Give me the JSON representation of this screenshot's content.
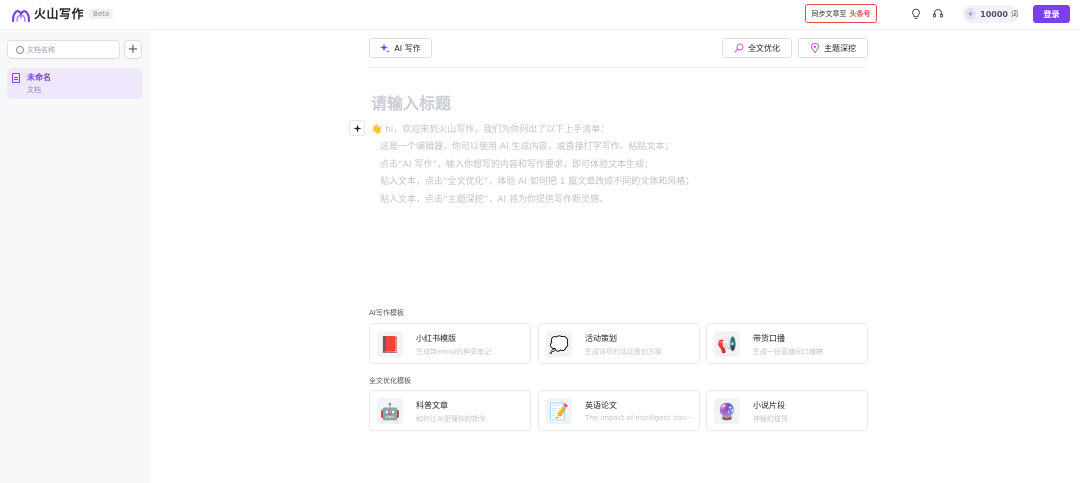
{
  "header": {
    "app_name": "火山写作",
    "beta": "Beta",
    "sync_label": "同步文章至",
    "sync_target": "头条号",
    "quota_value": "10000",
    "quota_unit": "词",
    "quota_badge": "+",
    "login_label": "登录",
    "brand_color": "#7b3ff2"
  },
  "sidebar": {
    "search_placeholder": "文档名称",
    "add_label": "+",
    "documents": [
      {
        "title": "未命名",
        "subtitle": "文档"
      }
    ]
  },
  "toolbar": {
    "ai_write": "AI 写作",
    "full_optimize": "全文优化",
    "topic_deepen": "主题深挖"
  },
  "editor": {
    "title_placeholder": "请输入标题",
    "intro_lines": [
      "👋 hi，欢迎来到火山写作，我们为你列出了以下上手清单：",
      "这是一个编辑器，你可以使用 AI 生成内容，或直接打字写作、粘贴文本；",
      "点击“AI 写作”，输入你想写的内容和写作要求，即可体验文本生成；",
      "贴入文本，点击“全文优化”，体验 AI 如何把 1 篇文章改成不同的文体和风格；",
      "贴入文本，点击“主题深挖”，AI 将为你提供写作新灵感。"
    ]
  },
  "templates": {
    "ai_section_label": "AI写作模板",
    "ai_templates": [
      {
        "icon": "📕",
        "title": "小红书模版",
        "subtitle": "生成带emoji的种草笔记"
      },
      {
        "icon": "💭",
        "title": "活动策划",
        "subtitle": "生成详尽的活动策划方案"
      },
      {
        "icon": "📢",
        "title": "带货口播",
        "subtitle": "生成一份直播间口播稿"
      }
    ],
    "optimize_section_label": "全文优化模板",
    "optimize_templates": [
      {
        "icon": "🤖",
        "title": "科普文章",
        "subtitle": "如何让AI更懂你的指令"
      },
      {
        "icon": "📝",
        "title": "英语论文",
        "subtitle": "The impact of intelligent hou···"
      },
      {
        "icon": "🔮",
        "title": "小说片段",
        "subtitle": "神秘的提货"
      }
    ]
  }
}
